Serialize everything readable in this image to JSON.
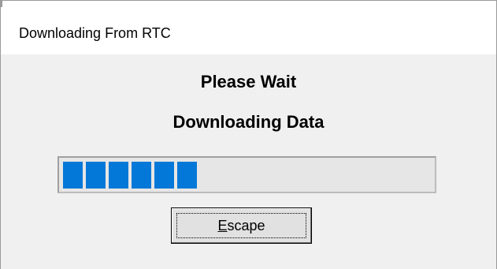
{
  "window": {
    "title": "Downloading From RTC"
  },
  "message": {
    "line1": "Please Wait",
    "line2": "Downloading Data"
  },
  "progress": {
    "filled_chunks": 6,
    "fraction_complete": 0.35,
    "bar_color": "#0478d8"
  },
  "escape_button": {
    "mnemonic": "E",
    "rest": "scape"
  }
}
